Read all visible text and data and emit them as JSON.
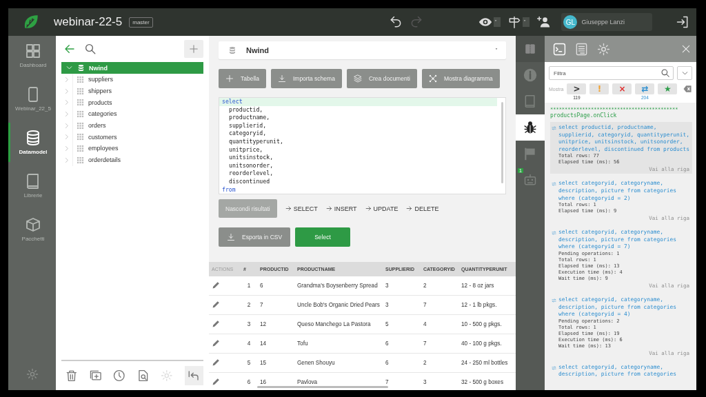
{
  "header": {
    "title": "webinar-22-5",
    "branch": "master",
    "user": {
      "initials": "GL",
      "name": "Giuseppe Lanzi"
    }
  },
  "nav": {
    "items": [
      {
        "label": "Dashboard",
        "selected": false
      },
      {
        "label": "Webinar_22_5",
        "selected": false
      },
      {
        "label": "Datamodel",
        "selected": true
      },
      {
        "label": "Librerie",
        "selected": false
      },
      {
        "label": "Pacchetti",
        "selected": false
      }
    ]
  },
  "tree": {
    "label": "Nwind",
    "expanded": true,
    "selected": true,
    "children": [
      {
        "label": "suppliers",
        "expanded": false
      },
      {
        "label": "shippers",
        "expanded": false
      },
      {
        "label": "products",
        "expanded": false
      },
      {
        "label": "categories",
        "expanded": false
      },
      {
        "label": "orders",
        "expanded": false
      },
      {
        "label": "customers",
        "expanded": false
      },
      {
        "label": "employees",
        "expanded": false
      },
      {
        "label": "orderdetails",
        "expanded": false
      }
    ]
  },
  "main": {
    "database": "Nwind",
    "toolbar": [
      "Tabella",
      "Importa schema",
      "Crea documenti",
      "Mostra diagramma"
    ],
    "editor": {
      "lines": [
        {
          "text": "select",
          "kind": "keyword",
          "current": true
        },
        {
          "text": "productid,",
          "kind": "field",
          "current": false
        },
        {
          "text": "productname,",
          "kind": "field",
          "current": false
        },
        {
          "text": "supplierid,",
          "kind": "field",
          "current": false
        },
        {
          "text": "categoryid,",
          "kind": "field",
          "current": false
        },
        {
          "text": "quantityperunit,",
          "kind": "field",
          "current": false
        },
        {
          "text": "unitprice,",
          "kind": "field",
          "current": false
        },
        {
          "text": "unitsinstock,",
          "kind": "field",
          "current": false
        },
        {
          "text": "unitsonorder,",
          "kind": "field",
          "current": false
        },
        {
          "text": "reorderlevel,",
          "kind": "field",
          "current": false
        },
        {
          "text": "discontinued",
          "kind": "field",
          "current": false
        },
        {
          "text": "from",
          "kind": "keyword",
          "current": false
        }
      ]
    },
    "hide_results": "Nascondi risultati",
    "snippets": [
      "SELECT",
      "INSERT",
      "UPDATE",
      "DELETE"
    ],
    "actions": [
      {
        "label": "Esporta in CSV",
        "kind": "secondary"
      },
      {
        "label": "Select",
        "kind": "primary"
      }
    ],
    "table": {
      "columns": [
        "ACTIONS",
        "#",
        "PRODUCTID",
        "PRODUCTNAME",
        "SUPPLIERID",
        "CATEGORYID",
        "QUANTITYPERUNIT"
      ],
      "rows": [
        [
          "",
          "1",
          "6",
          "Grandma's Boysenberry Spread",
          "3",
          "2",
          "12 - 8 oz jars"
        ],
        [
          "",
          "2",
          "7",
          "Uncle Bob's Organic Dried Pears",
          "3",
          "7",
          "12 - 1 lb pkgs."
        ],
        [
          "",
          "3",
          "12",
          "Queso Manchego La Pastora",
          "5",
          "4",
          "10 - 500 g pkgs."
        ],
        [
          "",
          "4",
          "14",
          "Tofu",
          "6",
          "7",
          "40 - 100 g pkgs."
        ],
        [
          "",
          "5",
          "15",
          "Genen Shouyu",
          "6",
          "2",
          "24 - 250 ml bottles"
        ],
        [
          "",
          "6",
          "16",
          "Pavlova",
          "7",
          "3",
          "32 - 500 g boxes"
        ]
      ]
    }
  },
  "rail": {
    "items": [
      {
        "selected": false
      },
      {
        "selected": false
      },
      {
        "selected": true
      },
      {
        "selected": false
      },
      {
        "selected": false,
        "badge": "1"
      }
    ]
  },
  "console": {
    "tabs": [
      {
        "selected": true
      },
      {
        "selected": false
      },
      {
        "selected": false
      }
    ],
    "filter": {
      "placeholder": "Filtra"
    },
    "show_label": "Mostra",
    "filters": [
      {
        "symbol": ">",
        "color": "#333333",
        "count": "119"
      },
      {
        "symbol": "!",
        "color": "#f0a030"
      },
      {
        "symbol": "×",
        "color": "#e03030"
      },
      {
        "symbol": "⇄",
        "color": "#2f8fd0",
        "count": "204"
      },
      {
        "symbol": "★",
        "color": "#2e9e4a"
      }
    ],
    "separator": "********************************************",
    "event": "productsPage.onClick",
    "entries": [
      {
        "query": "select productid, productname, supplierid, categoryid, quantityperunit, unitprice, unitsinstock, unitsonorder, reorderlevel, discontinued from products",
        "details": [
          "Total rows: 77",
          "Elapsed time (ms): 56"
        ],
        "link": "Vai alla riga",
        "selected": true
      },
      {
        "query": "select categoryid, categoryname, description, picture from categories where (categoryid = 2)",
        "details": [
          "Total rows: 1",
          "Elapsed time (ms): 9"
        ],
        "link": "Vai alla riga",
        "selected": false
      },
      {
        "query": "select categoryid, categoryname, description, picture from categories where (categoryid = 7)",
        "details": [
          "Pending operations: 1",
          "Total rows: 1",
          "Elapsed time (ms): 13",
          "Execution time (ms): 4",
          "Wait time (ms): 9"
        ],
        "link": "Vai alla riga",
        "selected": false
      },
      {
        "query": "select categoryid, categoryname, description, picture from categories where (categoryid = 4)",
        "details": [
          "Pending operations: 2",
          "Total rows: 1",
          "Elapsed time (ms): 19",
          "Execution time (ms): 6",
          "Wait time (ms): 13"
        ],
        "link": "Vai alla riga",
        "selected": false
      },
      {
        "query": "select categoryid, categoryname, description, picture from categories",
        "selected": false
      }
    ]
  }
}
